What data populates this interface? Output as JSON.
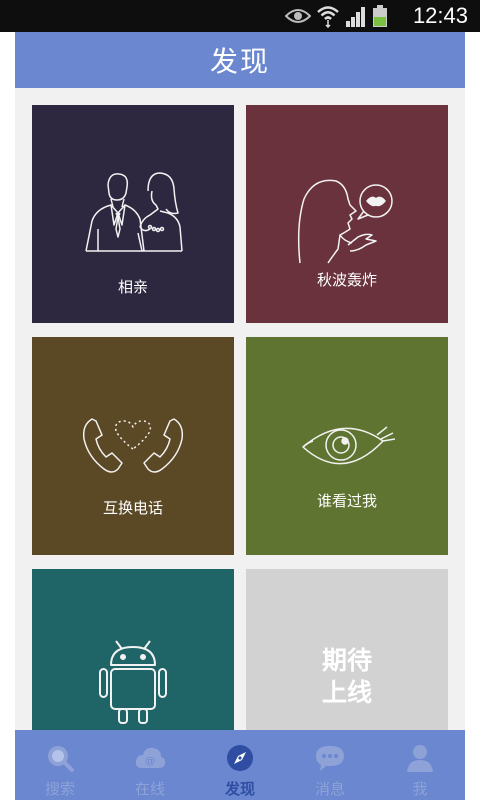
{
  "status_bar": {
    "time": "12:43"
  },
  "header": {
    "title": "发现"
  },
  "tiles": [
    {
      "label": "相亲",
      "color": "#2d283f",
      "icon": "couple-icon"
    },
    {
      "label": "秋波轰炸",
      "color": "#69323d",
      "icon": "face-speech-kiss-icon"
    },
    {
      "label": "互换电话",
      "color": "#5b4825",
      "icon": "phone-heart-icon"
    },
    {
      "label": "谁看过我",
      "color": "#5f7430",
      "icon": "eye-icon"
    },
    {
      "label": "",
      "color": "#1f6466",
      "icon": "android-robot-icon"
    },
    {
      "label": "期待\n上线",
      "color": "#d2d2d2",
      "icon": ""
    }
  ],
  "coming_soon": {
    "line1": "期待",
    "line2": "上线"
  },
  "tabbar": {
    "active_color": "#2f4ea3",
    "items": [
      {
        "label": "搜索",
        "icon": "search-icon",
        "active": false
      },
      {
        "label": "在线",
        "icon": "online-cloud-icon",
        "active": false
      },
      {
        "label": "发现",
        "icon": "compass-icon",
        "active": true
      },
      {
        "label": "消息",
        "icon": "message-bubble-icon",
        "active": false
      },
      {
        "label": "我",
        "icon": "profile-icon",
        "active": false
      }
    ]
  }
}
